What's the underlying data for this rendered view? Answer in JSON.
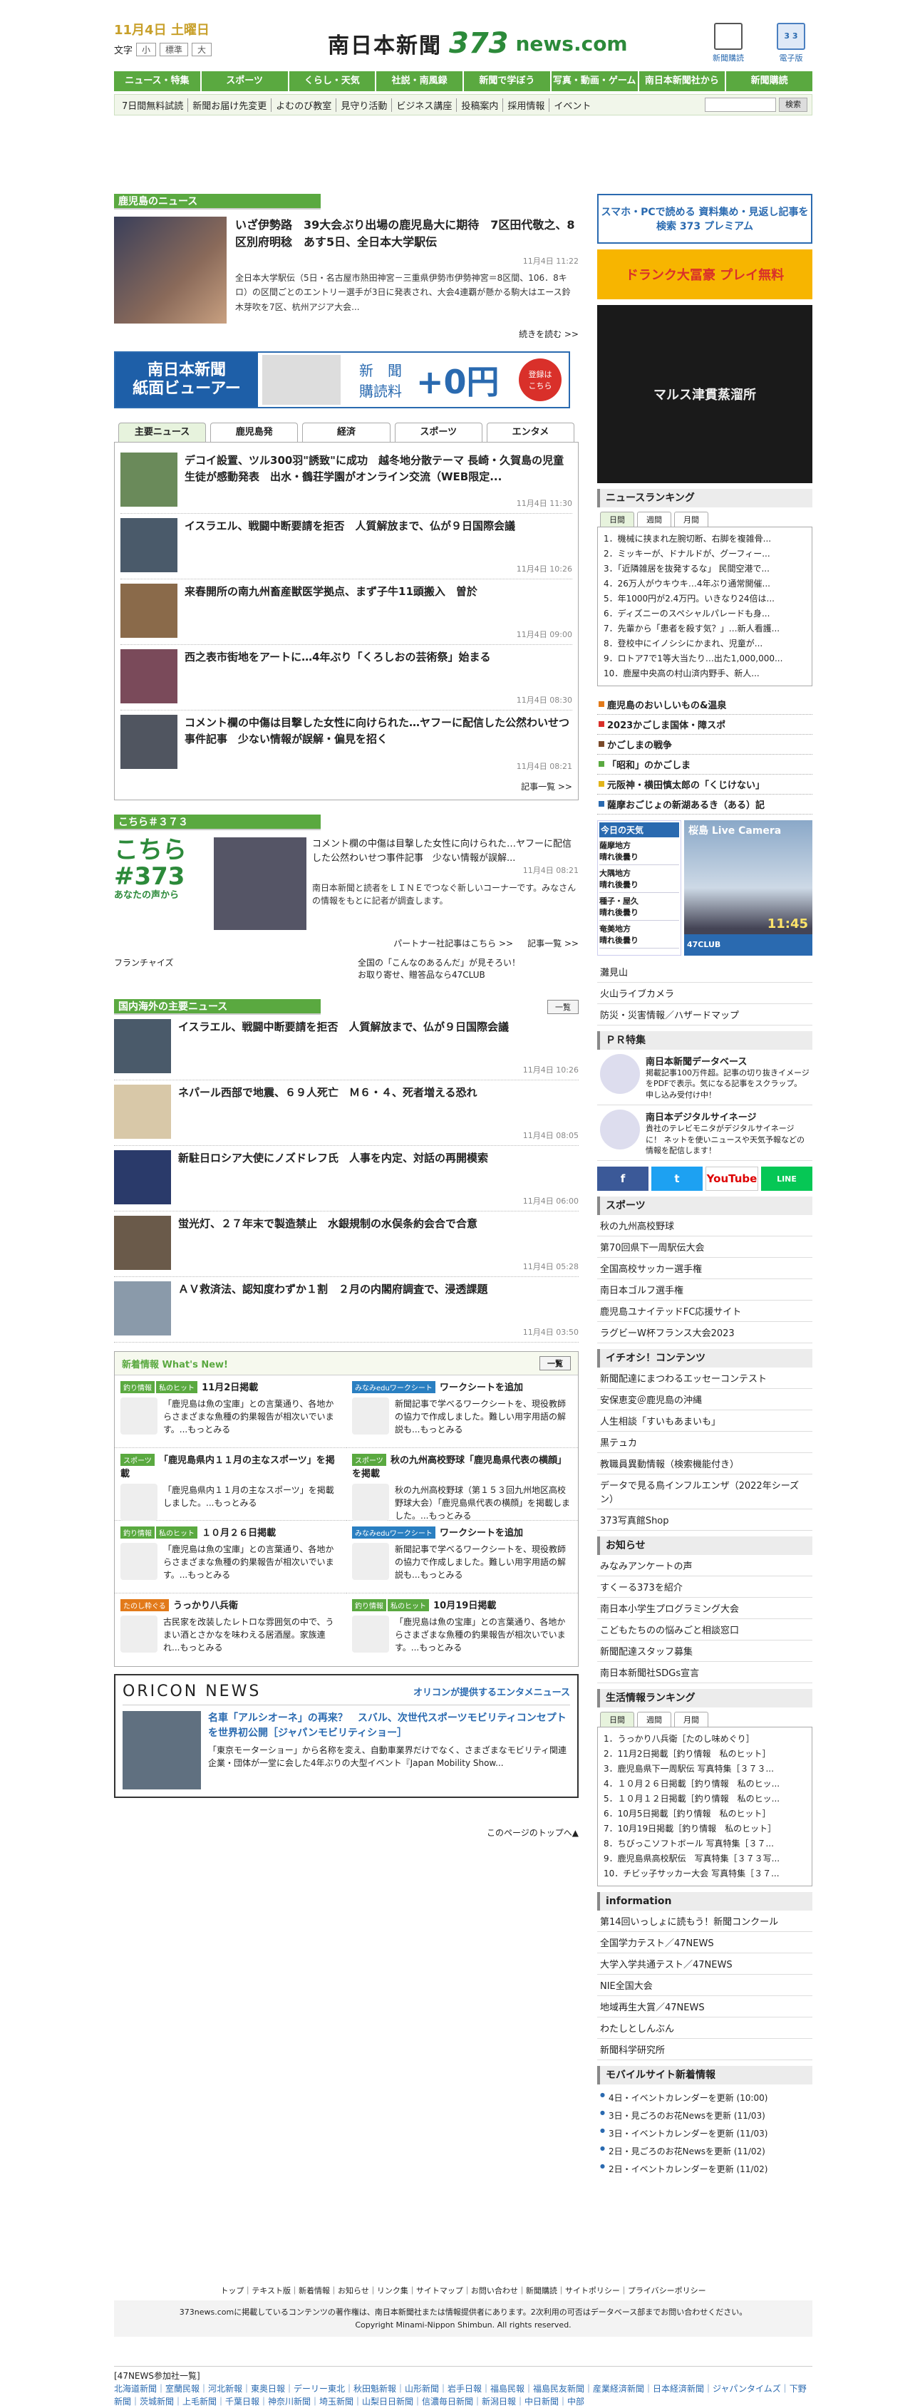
{
  "header": {
    "date": "11月4日 土曜日",
    "font_label": "文字",
    "font_sizes": [
      "小",
      "標準",
      "大"
    ],
    "logo_jp": "南日本新聞",
    "logo_num": "373",
    "logo_domain": "news.com",
    "icon1_label": "新聞購読",
    "icon2_label": "電子版",
    "icon2_glyph": "3 3"
  },
  "nav": [
    "ニュース・特集",
    "スポーツ",
    "くらし・天気",
    "社説・南風録",
    "新聞で学ぼう",
    "写真・動画・ゲーム",
    "南日本新聞社から",
    "新聞購読"
  ],
  "subnav": [
    "7日間無料試読",
    "新聞お届け先変更",
    "よむのび教室",
    "見守り活動",
    "ビジネス講座",
    "投稿案内",
    "採用情報",
    "イベント"
  ],
  "search_button": "検索",
  "kagoshima": {
    "section": "鹿児島のニュース",
    "lead_title": "いざ伊勢路　39大会ぶり出場の鹿児島大に期待　7区田代敬之、8区別府明稔　あす5日、全日本大学駅伝",
    "lead_time": "11月4日 11:22",
    "lead_body": "全日本大学駅伝（5日・名古屋市熱田神宮－三重県伊勢市伊勢神宮＝8区間、106．8キロ）の区間ごとのエントリー選手が3日に発表され、大会4連覇が懸かる駒大はエース鈴木芽吹を7区、杭州アジア大会...",
    "more": "続きを読む >>"
  },
  "banner": {
    "left": "南日本新聞\n紙面ビューアー",
    "mid": "新　聞\n購読料",
    "plus": "+0円",
    "badge": "登録は\nこちら"
  },
  "tabs": [
    "主要ニュース",
    "鹿児島発",
    "経済",
    "スポーツ",
    "エンタメ"
  ],
  "news": [
    {
      "title": "デコイ設置、ツル300羽\"誘致\"に成功　越冬地分散テーマ 長崎・久賀島の児童生徒が感動発表　出水・鶴荘学園がオンライン交流（WEB限定...",
      "time": "11月4日 11:30"
    },
    {
      "title": "イスラエル、戦闘中断要請を拒否　人質解放まで、仏が９日国際会議",
      "time": "11月4日 10:26"
    },
    {
      "title": "来春開所の南九州畜産獣医学拠点、まず子牛11頭搬入　曽於",
      "time": "11月4日 09:00"
    },
    {
      "title": "西之表市街地をアートに…4年ぶり「くろしおの芸術祭」始まる",
      "time": "11月4日 08:30"
    },
    {
      "title": "コメント欄の中傷は目撃した女性に向けられた…ヤフーに配信した公然わいせつ事件記事　少ない情報が誤解・偏見を招く",
      "time": "11月4日 08:21"
    }
  ],
  "list_more": "記事一覧 >>",
  "kochira": {
    "section": "こちら＃３７３",
    "logo": "こちら\n#373",
    "logo_sub": "あなたの声から",
    "title": "コメント欄の中傷は目撃した女性に向けられた…ヤフーに配信した公然わいせつ事件記事　少ない情報が誤解...",
    "time": "11月4日 08:21",
    "desc": "南日本新聞と読者をＬＩＮＥでつなぐ新しいコーナーです。みなさんの情報をもとに記者が調査します。",
    "partner": "パートナー社記事はこちら >>",
    "articles": "記事一覧 >>",
    "franchise": "フランチャイズ",
    "fran_right": "全国の「こんなのあるんだ」が見そろい！\nお取り寄せ、贈答品なら47CLUB"
  },
  "national": {
    "section": "国内海外の主要ニュース",
    "btn": "一覧",
    "items": [
      {
        "title": "イスラエル、戦闘中断要請を拒否　人質解放まで、仏が９日国際会議",
        "time": "11月4日 10:26"
      },
      {
        "title": "ネパール西部で地震、６９人死亡　Ｍ６・４、死者増える恐れ",
        "time": "11月4日 08:05"
      },
      {
        "title": "新駐日ロシア大使にノズドレフ氏　人事を内定、対話の再開模索",
        "time": "11月4日 06:00"
      },
      {
        "title": "蛍光灯、２７年末で製造禁止　水銀規制の水俣条約会合で合意",
        "time": "11月4日 05:28"
      },
      {
        "title": "ＡＶ救済法、認知度わずか１割　２月の内閣府調査で、浸透課題",
        "time": "11月4日 03:50"
      }
    ]
  },
  "whatsnew": {
    "title": "新着情報 What's New!",
    "btn": "一覧",
    "cells": [
      {
        "tags": [
          "釣り情報",
          "私のヒット"
        ],
        "title": "11月2日掲載",
        "body": "「鹿児島は魚の宝庫」との言葉通り、各地からさまざまな魚種の釣果報告が相次いでいます。...もっとみる"
      },
      {
        "tags": [
          "みなみeduワークシート"
        ],
        "title": "ワークシートを追加",
        "body": "新聞記事で学べるワークシートを、現役教師の協力で作成しました。難しい用字用語の解説も...もっとみる"
      },
      {
        "tags": [
          "スポーツ"
        ],
        "title": "「鹿児島県内１１月の主なスポーツ」を掲載",
        "body": "「鹿児島県内１１月の主なスポーツ」を掲載しました。...もっとみる"
      },
      {
        "tags": [
          "スポーツ"
        ],
        "title": "秋の九州高校野球「鹿児島県代表の横顔」を掲載",
        "body": "秋の九州高校野球（第１５３回九州地区高校野球大会）「鹿児島県代表の横顔」を掲載しました。...もっとみる"
      },
      {
        "tags": [
          "釣り情報",
          "私のヒット"
        ],
        "title": "１０月２６日掲載",
        "body": "「鹿児島は魚の宝庫」との言葉通り、各地からさまざまな魚種の釣果報告が相次いでいます。...もっとみる"
      },
      {
        "tags": [
          "みなみeduワークシート"
        ],
        "title": "ワークシートを追加",
        "body": "新聞記事で学べるワークシートを、現役教師の協力で作成しました。難しい用字用語の解説も...もっとみる"
      },
      {
        "tags": [
          "たのし粋ぐる"
        ],
        "title": "うっかり八兵衛",
        "body": "古民家を改装したレトロな雰囲気の中で、うまい酒とさかなを味わえる居酒屋。家族連れ...もっとみる"
      },
      {
        "tags": [
          "釣り情報",
          "私のヒット"
        ],
        "title": "10月19日掲載",
        "body": "「鹿児島は魚の宝庫」との言葉通り、各地からさまざまな魚種の釣果報告が相次いでいます。...もっとみる"
      }
    ]
  },
  "oricon": {
    "brand": "ORICON NEWS",
    "sub": "オリコンが提供するエンタメニュース",
    "headline": "名車「アルシオーネ」の再来？　スバル、次世代スポーツモビリティコンセプトを世界初公開［ジャパンモビリティショー］",
    "desc": "「東京モーターショー」から名称を変え、自動車業界だけでなく、さまざまなモビリティ関連企業・団体が一堂に会した4年ぶりの大型イベント『Japan Mobility Show..."
  },
  "page_top": "このページのトップへ▲",
  "right": {
    "ad1": "スマホ・PCで読める 資料集め・見返し記事を検索 373 プレミアム",
    "ad2": "ドランク大冨豪 プレイ無料",
    "ad3": "マルス津貫蒸溜所",
    "ranking_title": "ニュースランキング",
    "rank_tabs": [
      "日間",
      "週間",
      "月間"
    ],
    "ranking": [
      "1．機械に挟まれ左腕切断、右脚を複雑骨...",
      "2．ミッキーが、ドナルドが、グーフィー...",
      "3．「近隣雑居を抜発するな」 民間空港で...",
      "4．26万人がウキウキ…4年ぶり通常開催...",
      "5．年1000円が2.4万円。いきなり24倍は...",
      "6．ディズニーのスペシャルパレードも身...",
      "7．先輩から「患者を殺す気？」…新人看護...",
      "8．登校中にイノシシにかまれ、児童が...",
      "9．ロトア7で1等大当たり…出た1,000,000...",
      "10．鹿屋中央高の村山済内野手、新人..."
    ],
    "special": [
      {
        "t": "鹿児島のおいしいもの&温泉",
        "c": "#e27a1a"
      },
      {
        "t": "2023かごしま国体・障スポ",
        "c": "#d9302a"
      },
      {
        "t": "かごしまの戦争",
        "c": "#7a4a2a"
      },
      {
        "t": "「昭和」のかごしま",
        "c": "#5aa940"
      },
      {
        "t": "元阪神・横田慎太郎の「くじけない」",
        "c": "#e2b51a"
      },
      {
        "t": "薩摩おごじょの新湖あるき（ある）記",
        "c": "#2a6ab0"
      }
    ],
    "weather": {
      "hd": "今日の天気",
      "rows": [
        "薩摩地方\n晴れ後曇り",
        "大隅地方\n晴れ後曇り",
        "種子・屋久\n晴れ後曇り",
        "奄美地方\n晴れ後曇り"
      ],
      "cam": "桜島 Live Camera",
      "clock": "11:45",
      "club": "47CLUB"
    },
    "links1": [
      "灘見山",
      "火山ライブカメラ",
      "防災・災害情報／ハザードマップ"
    ],
    "pr_title": "ＰＲ特集",
    "pr": [
      {
        "t": "南日本新聞データベース",
        "d": "掲載記事100万件超。記事の切り抜きイメージをPDFで表示。気になる記事をスクラップ。申し込み受付け中！"
      },
      {
        "t": "南日本デジタルサイネージ",
        "d": "貴社のテレビモニタがデジタルサイネージに！ ネットを使いニュースや天気予報などの情報を配信します！"
      }
    ],
    "sns": [
      "f",
      "t",
      "YouTube",
      "LINE"
    ],
    "sports_title": "スポーツ",
    "sports": [
      "秋の九州高校野球",
      "第70回県下一周駅伝大会",
      "全国高校サッカー選手権",
      "南日本ゴルフ選手権",
      "鹿児島ユナイテッドFC応援サイト",
      "ラグビーW杯フランス大会2023"
    ],
    "contents_title": "イチオシ！コンテンツ",
    "contents": [
      "新聞配達にまつわるエッセーコンテスト",
      "安保恵変＠鹿児島の沖縄",
      "人生相談「すいもあまいも」",
      "黒テュカ",
      "教職員異動情報（検索機能付き）",
      "データで見る鳥インフルエンザ（2022年シーズン）",
      "373写真館Shop"
    ],
    "notice_title": "お知らせ",
    "notice": [
      "みなみアンケートの声",
      "すくーる373を紹介",
      "南日本小学生プログラミング大会",
      "こどもたちのの悩みごと相談窓口",
      "新聞配達スタッフ募集",
      "南日本新聞社SDGs宣言"
    ],
    "life_title": "生活情報ランキング",
    "life_tabs": [
      "日間",
      "週間",
      "月間"
    ],
    "life": [
      "1．うっかり八兵衛［たのし味めぐり］",
      "2．11月2日掲載［釣り情報　私のヒット］",
      "3．鹿児島県下一周駅伝 写真特集［３７３...",
      "4．１０月２６日掲載［釣り情報　私のヒッ...",
      "5．１０月１２日掲載［釣り情報　私のヒッ...",
      "6．10月5日掲載［釣り情報　私のヒット］",
      "7．10月19日掲載［釣り情報　私のヒット］",
      "8．ちびっこソフトボール 写真特集［３７...",
      "9．鹿児島県高校駅伝　写真特集［３７３写...",
      "10．チビッ子サッカー大会 写真特集［３７..."
    ],
    "info_title": "information",
    "info": [
      "第14回いっしょに読もう！新聞コンクール",
      "全国学力テスト／47NEWS",
      "大学入学共通テスト／47NEWS",
      "NIE全国大会",
      "地域再生大賞／47NEWS",
      "わたしとしんぶん",
      "新聞科学研究所"
    ],
    "mobile_title": "モバイルサイト新着情報",
    "mobile": [
      "4日・イベントカレンダーを更新 (10:00)",
      "3日・見ごろのお花Newsを更新 (11/03)",
      "3日・イベントカレンダーを更新 (11/03)",
      "2日・見ごろのお花Newsを更新 (11/02)",
      "2日・イベントカレンダーを更新 (11/02)"
    ]
  },
  "footer": {
    "links": "トップ｜テキスト版｜新着情報｜お知らせ｜リンク集｜サイトマップ｜お問い合わせ｜新聞購読｜サイトポリシー｜プライバシーポリシー",
    "copy1": "373news.comに掲載しているコンテンツの著作権は、南日本新聞社または情報提供者にあります。2次利用の可否はデータベース部までお問い合わせください。",
    "copy2": "Copyright Minami-Nippon Shimbun. All rights reserved.",
    "members_title": "[47NEWS参加社一覧]",
    "members": "北海道新聞｜室蘭民報｜河北新報｜東奥日報｜デーリー東北｜秋田魁新報｜山形新聞｜岩手日報｜福島民報｜福島民友新聞｜産業経済新聞｜日本経済新聞｜ジャパンタイムズ｜下野新聞｜茨城新聞｜上毛新聞｜千葉日報｜神奈川新聞｜埼玉新聞｜山梨日日新聞｜信濃毎日新聞｜新潟日報｜中日新聞｜中部"
  }
}
